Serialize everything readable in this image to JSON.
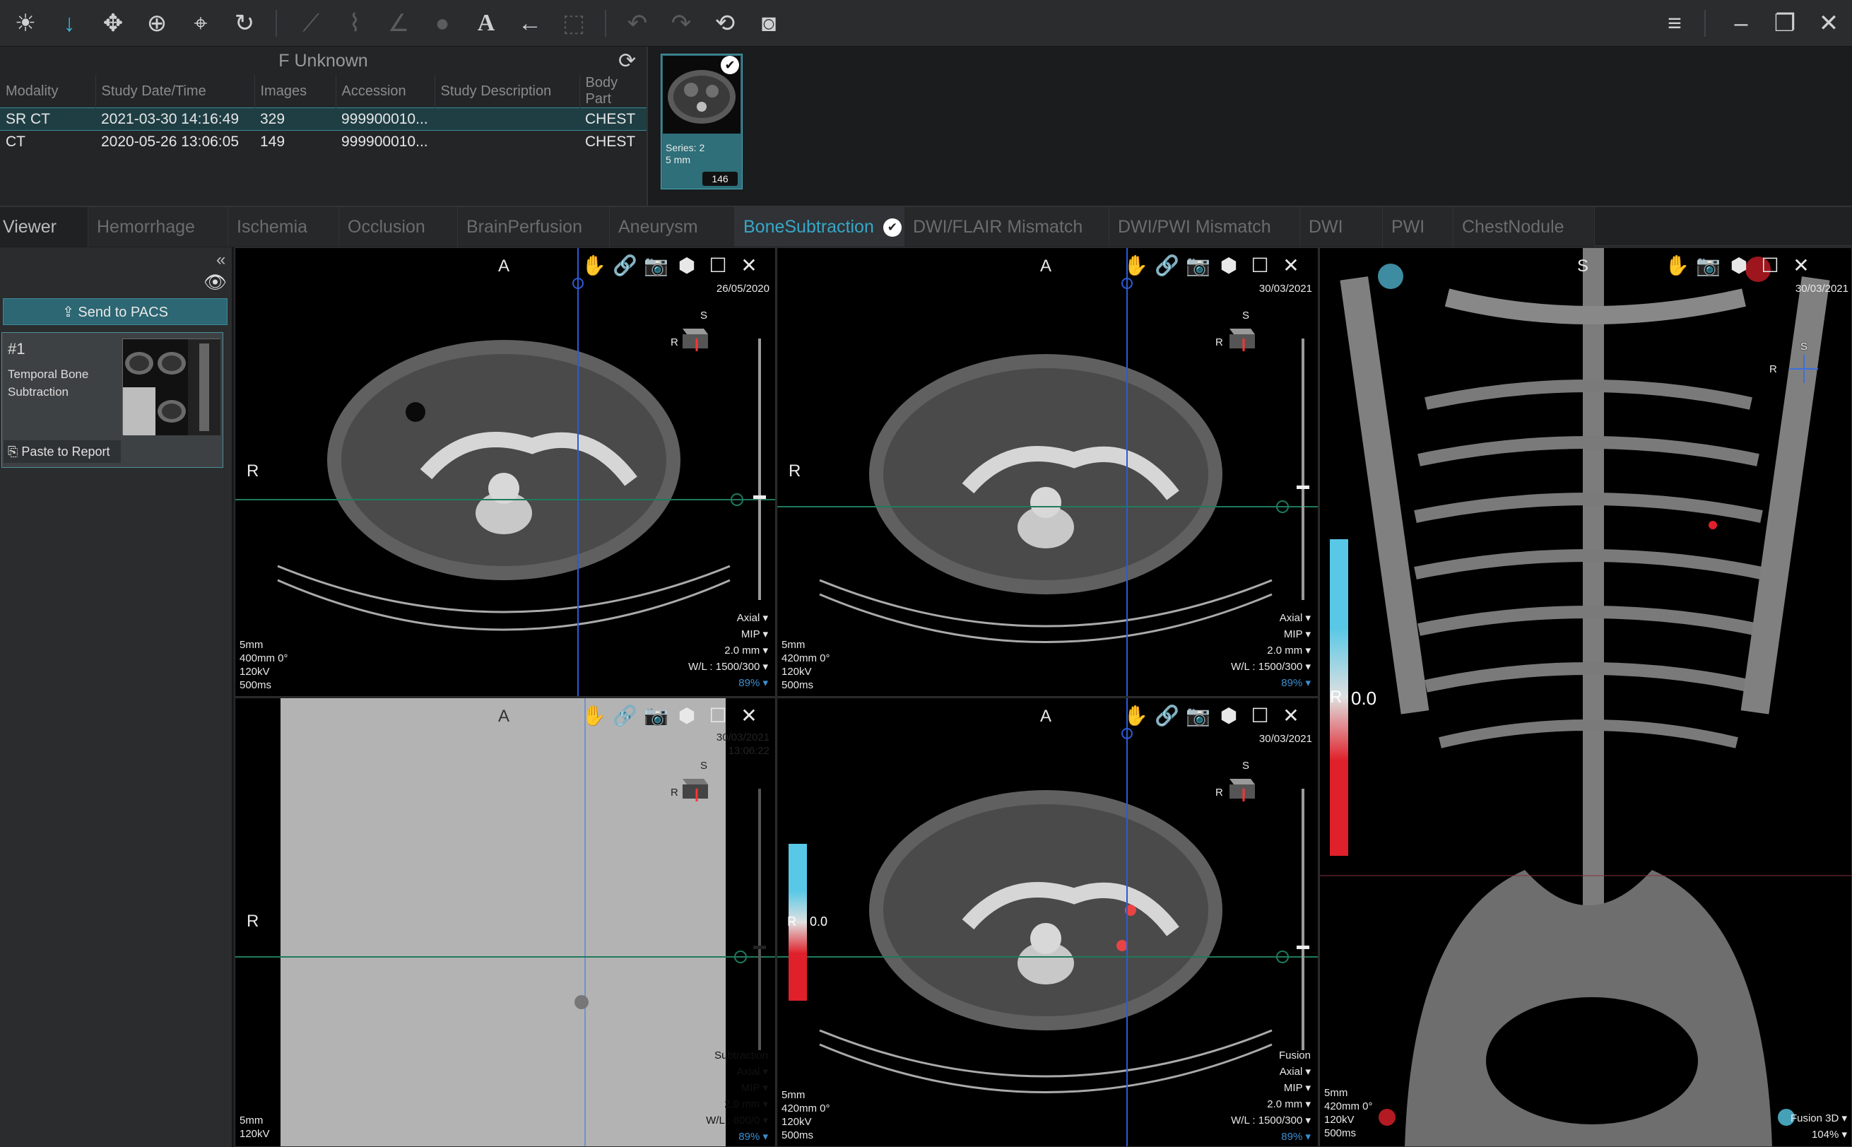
{
  "toolbar": {
    "tools": [
      {
        "name": "window-level-icon",
        "glyph": "☀",
        "state": "normal"
      },
      {
        "name": "scroll-icon",
        "glyph": "↓",
        "state": "active"
      },
      {
        "name": "pan-icon",
        "glyph": "✥",
        "state": "normal"
      },
      {
        "name": "zoom-icon",
        "glyph": "⊕",
        "state": "normal"
      },
      {
        "name": "crosshair-icon",
        "glyph": "⌖",
        "state": "normal"
      },
      {
        "name": "rotate-icon",
        "glyph": "↻",
        "state": "normal"
      },
      {
        "name": "ruler-icon",
        "glyph": "⟋",
        "state": "disabled"
      },
      {
        "name": "polyline-icon",
        "glyph": "⌇",
        "state": "disabled"
      },
      {
        "name": "angle-icon",
        "glyph": "∠",
        "state": "disabled"
      },
      {
        "name": "ellipse-roi-icon",
        "glyph": "●",
        "state": "disabled"
      },
      {
        "name": "text-annotation-icon",
        "glyph": "A",
        "state": "normal"
      },
      {
        "name": "arrow-annotation-icon",
        "glyph": "←",
        "state": "normal"
      },
      {
        "name": "crop-icon",
        "glyph": "⬚",
        "state": "disabled"
      },
      {
        "name": "undo-icon",
        "glyph": "↶",
        "state": "disabled"
      },
      {
        "name": "redo-icon",
        "glyph": "↷",
        "state": "disabled"
      },
      {
        "name": "reset-icon",
        "glyph": "⟲",
        "state": "normal"
      },
      {
        "name": "screenshot-icon",
        "glyph": "◙",
        "state": "normal"
      }
    ],
    "window": {
      "menu": "≡",
      "minimize": "–",
      "restore": "❐",
      "close": "✕"
    }
  },
  "study": {
    "patient": "F Unknown",
    "columns": [
      "Modality",
      "Study Date/Time",
      "Images",
      "Accession",
      "Study Description",
      "Body Part"
    ],
    "rows": [
      {
        "modality": "SR CT",
        "datetime": "2021-03-30 14:16:49",
        "images": "329",
        "accession": "999900010...",
        "description": "",
        "body_part": "CHEST",
        "selected": true
      },
      {
        "modality": "CT",
        "datetime": "2020-05-26 13:06:05",
        "images": "149",
        "accession": "999900010...",
        "description": "",
        "body_part": "CHEST",
        "selected": false
      }
    ]
  },
  "series": {
    "label_line1": "Series: 2",
    "label_line2": "5 mm",
    "count": "146"
  },
  "tabs": [
    "Viewer",
    "Hemorrhage",
    "Ischemia",
    "Occlusion",
    "BrainPerfusion",
    "Aneurysm",
    "BoneSubtraction",
    "DWI/FLAIR Mismatch",
    "DWI/PWI Mismatch",
    "DWI",
    "PWI",
    "ChestNodule"
  ],
  "active_tab": "BoneSubtraction",
  "left_panel": {
    "send_to_pacs": "Send to PACS",
    "procedure_number": "#1",
    "procedure_name": "Temporal Bone Subtraction",
    "paste_to_report": "Paste to Report"
  },
  "viewports": {
    "tl": {
      "top": "A",
      "left": "R",
      "bottom_small": "S",
      "cube_left": "R",
      "date": "26/05/2020",
      "time": "",
      "info": [
        "5mm",
        "400mm 0°",
        "120kV",
        "500ms"
      ],
      "right": [
        "Axial ▾",
        "MIP ▾",
        "2.0 mm ▾",
        "W/L : 1500/300 ▾"
      ],
      "zoom": "89% ▾",
      "label": ""
    },
    "tm": {
      "top": "A",
      "left": "R",
      "bottom_small": "S",
      "cube_left": "R",
      "date": "30/03/2021",
      "time": "",
      "info": [
        "5mm",
        "420mm 0°",
        "120kV",
        "500ms"
      ],
      "right": [
        "Axial ▾",
        "MIP ▾",
        "2.0 mm ▾",
        "W/L : 1500/300 ▾"
      ],
      "zoom": "89% ▾",
      "label": ""
    },
    "bl": {
      "top": "A",
      "left": "R",
      "bottom_small": "S",
      "cube_left": "R",
      "date": "30/03/2021",
      "time": "13:06:22",
      "info": [
        "5mm",
        "120kV"
      ],
      "right": [
        "Axial ▾",
        "MIP ▾",
        "2.0 mm ▾",
        "W/L : 800/0 ▾"
      ],
      "zoom": "89% ▾",
      "label": "Subtraction"
    },
    "bm": {
      "top": "A",
      "left": "R",
      "bottom_small": "S",
      "cube_left": "R",
      "date": "30/03/2021",
      "time": "",
      "info": [
        "5mm",
        "420mm 0°",
        "120kV",
        "500ms"
      ],
      "right": [
        "Axial ▾",
        "MIP ▾",
        "2.0 mm ▾",
        "W/L : 1500/300 ▾"
      ],
      "zoom": "89% ▾",
      "label": "Fusion",
      "colorbar_value": "0.0"
    },
    "r3d": {
      "top": "S",
      "cube_left": "R",
      "cube_top": "S",
      "date": "30/03/2021",
      "info": [
        "5mm",
        "420mm 0°",
        "120kV",
        "500ms"
      ],
      "label": "Fusion 3D ▾",
      "zoom": "104% ▾",
      "colorbar_value": "0.0"
    }
  },
  "colors": {
    "accent": "#37a7c8",
    "selected_row": "#1f3e44",
    "colorbar_top": "#58c8e6",
    "colorbar_bottom": "#e0202a"
  }
}
